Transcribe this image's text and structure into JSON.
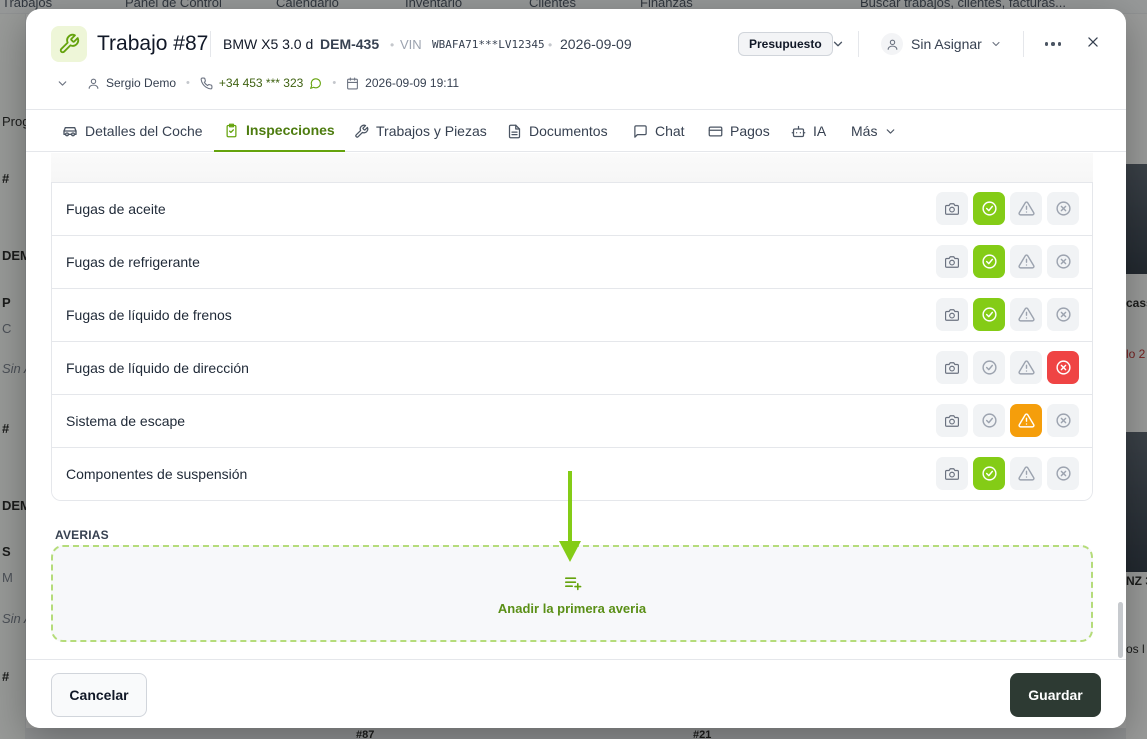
{
  "background": {
    "top_nav": [
      "Trabajos",
      "Panel de Control",
      "Calendario",
      "Inventario",
      "Clientes",
      "Finanzas"
    ],
    "search_placeholder": "Buscar trabajos, clientes, facturas...",
    "left_fragments": [
      "Prog",
      "#",
      "DEM",
      "P",
      "C",
      "Sin A",
      "#",
      "DEM",
      "S",
      "M",
      "Sin A",
      "#"
    ],
    "right_fragments": [
      "cass",
      "lo 2",
      "NZ 3",
      "os l"
    ],
    "bottom_fragments": [
      "#87",
      "#21"
    ]
  },
  "modal": {
    "title": "Trabajo #87",
    "car_model": "BMW X5 3.0 d",
    "plate": "DEM-435",
    "vin_label": "VIN",
    "vin_value": "WBAFA71***LV12345",
    "date": "2026-09-09",
    "status_label": "Presupuesto",
    "assignee": "Sin Asignar",
    "meta": {
      "customer": "Sergio Demo",
      "phone": "+34 453 *** 323",
      "datetime": "2026-09-09 19:11"
    },
    "tabs": [
      {
        "label": "Detalles del Coche",
        "icon": "car-icon"
      },
      {
        "label": "Inspecciones",
        "icon": "clipboard-check-icon"
      },
      {
        "label": "Trabajos y Piezas",
        "icon": "wrench-icon"
      },
      {
        "label": "Documentos",
        "icon": "document-icon"
      },
      {
        "label": "Chat",
        "icon": "chat-icon"
      },
      {
        "label": "Pagos",
        "icon": "credit-card-icon"
      },
      {
        "label": "IA",
        "icon": "robot-icon"
      },
      {
        "label": "Más",
        "icon": "chevron-down-icon"
      }
    ],
    "active_tab": "Inspecciones",
    "inspection_items": [
      {
        "name": "Fugas de aceite",
        "status": "ok"
      },
      {
        "name": "Fugas de refrigerante",
        "status": "ok"
      },
      {
        "name": "Fugas de líquido de frenos",
        "status": "ok"
      },
      {
        "name": "Fugas de líquido de dirección",
        "status": "fail"
      },
      {
        "name": "Sistema de escape",
        "status": "warning"
      },
      {
        "name": "Componentes de suspensión",
        "status": "ok"
      }
    ],
    "averias_label": "AVERIAS",
    "add_averia_label": "Anadir la primera averia",
    "cancel_label": "Cancelar",
    "save_label": "Guardar"
  },
  "colors": {
    "accent_green": "#84cc16",
    "warning_orange": "#f59e0b",
    "fail_red": "#ef4444",
    "save_button": "#2d3a33",
    "active_tab_text": "#4d7c0f"
  }
}
